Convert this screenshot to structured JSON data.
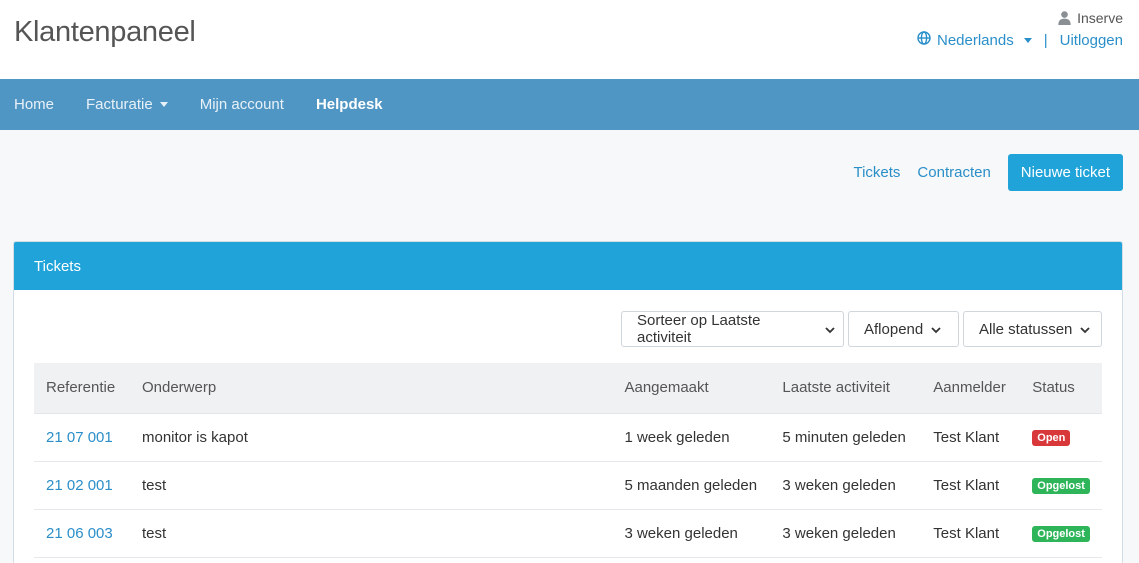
{
  "app": {
    "title": "Klantenpaneel"
  },
  "user": {
    "name": "Inserve",
    "icon": "user-icon"
  },
  "top_links": {
    "language": "Nederlands",
    "separator": "|",
    "logout": "Uitloggen",
    "language_icon": "globe-icon"
  },
  "nav": {
    "items": [
      {
        "label": "Home"
      },
      {
        "label": "Facturatie"
      },
      {
        "label": "Mijn account"
      },
      {
        "label": "Helpdesk"
      }
    ]
  },
  "actions": {
    "tickets": "Tickets",
    "contracts": "Contracten",
    "new_ticket": "Nieuwe ticket"
  },
  "panel": {
    "title": "Tickets"
  },
  "filters": {
    "sort": "Sorteer op Laatste activiteit",
    "order": "Aflopend",
    "status": "Alle statussen"
  },
  "table": {
    "headers": [
      "Referentie",
      "Onderwerp",
      "Aangemaakt",
      "Laatste activiteit",
      "Aanmelder",
      "Status"
    ],
    "rows": [
      {
        "ref": "21 07 001",
        "subject": "monitor is kapot",
        "created": "1 week geleden",
        "last_activity": "5 minuten geleden",
        "reporter": "Test Klant",
        "status": "Open",
        "status_color": "#d9383a"
      },
      {
        "ref": "21 02 001",
        "subject": "test",
        "created": "5 maanden geleden",
        "last_activity": "3 weken geleden",
        "reporter": "Test Klant",
        "status": "Opgelost",
        "status_color": "#2eb55a"
      },
      {
        "ref": "21 06 003",
        "subject": "test",
        "created": "3 weken geleden",
        "last_activity": "3 weken geleden",
        "reporter": "Test Klant",
        "status": "Opgelost",
        "status_color": "#2eb55a"
      }
    ]
  },
  "colors": {
    "nav_bg": "#5096c4",
    "accent": "#1fa3d9",
    "link": "#2a8fc9"
  }
}
